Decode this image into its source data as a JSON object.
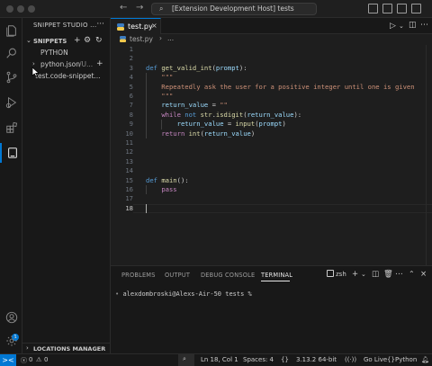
{
  "titlebar": {
    "back_icon": "arrow-left",
    "forward_icon": "arrow-right",
    "search_text": "[Extension Development Host] tests",
    "search_icon": "search-icon"
  },
  "activitybar": {
    "items": [
      "explorer-icon",
      "search-icon",
      "source-control-icon",
      "run-debug-icon",
      "extensions-icon",
      "snippet-studio-icon"
    ],
    "account_badge": "1"
  },
  "sidebar": {
    "title": "SNIPPET STUDIO ...",
    "more": "···",
    "section_label": "SNIPPETS",
    "section_chevron": "⌄",
    "tree": {
      "group": "PYTHON",
      "file1_chevron": "›",
      "file1": "python.json",
      "file1_detail": "/U...",
      "file1_add": "+",
      "file2": "test.code-snippet..."
    },
    "locations_label": "LOCATIONS MANAGER",
    "locations_chevron": "›"
  },
  "editor": {
    "tab_label": "test.py",
    "tab_close": "×",
    "breadcrumb_file": "test.py",
    "breadcrumb_sep": "›",
    "breadcrumb_more": "...",
    "lines": [
      {
        "n": "1",
        "segments": []
      },
      {
        "n": "2",
        "segments": []
      },
      {
        "n": "3",
        "segments": [
          {
            "t": "def ",
            "c": "kwb"
          },
          {
            "t": "get_valid_int",
            "c": "fn"
          },
          {
            "t": "(",
            "c": "df"
          },
          {
            "t": "prompt",
            "c": "vr"
          },
          {
            "t": "):",
            "c": "df"
          }
        ]
      },
      {
        "n": "4",
        "segments": [
          {
            "t": "    \"\"\"",
            "c": "st"
          }
        ]
      },
      {
        "n": "5",
        "segments": [
          {
            "t": "    Repeatedly ask the user for a positive integer until one is given",
            "c": "st"
          }
        ]
      },
      {
        "n": "6",
        "segments": [
          {
            "t": "    \"\"\"",
            "c": "st"
          }
        ]
      },
      {
        "n": "7",
        "segments": [
          {
            "t": "    ",
            "c": "df"
          },
          {
            "t": "return_value",
            "c": "vr"
          },
          {
            "t": " = ",
            "c": "df"
          },
          {
            "t": "\"\"",
            "c": "st"
          }
        ]
      },
      {
        "n": "8",
        "segments": [
          {
            "t": "    ",
            "c": "df"
          },
          {
            "t": "while",
            "c": "kw"
          },
          {
            "t": " ",
            "c": "df"
          },
          {
            "t": "not",
            "c": "kwb"
          },
          {
            "t": " ",
            "c": "df"
          },
          {
            "t": "str",
            "c": "fn"
          },
          {
            "t": ".",
            "c": "df"
          },
          {
            "t": "isdigit",
            "c": "fn"
          },
          {
            "t": "(",
            "c": "df"
          },
          {
            "t": "return_value",
            "c": "vr"
          },
          {
            "t": "):",
            "c": "df"
          }
        ]
      },
      {
        "n": "9",
        "segments": [
          {
            "t": "        ",
            "c": "df"
          },
          {
            "t": "return_value",
            "c": "vr"
          },
          {
            "t": " = ",
            "c": "df"
          },
          {
            "t": "input",
            "c": "fn"
          },
          {
            "t": "(",
            "c": "df"
          },
          {
            "t": "prompt",
            "c": "vr"
          },
          {
            "t": ")",
            "c": "df"
          }
        ]
      },
      {
        "n": "10",
        "segments": [
          {
            "t": "    ",
            "c": "df"
          },
          {
            "t": "return",
            "c": "kw"
          },
          {
            "t": " ",
            "c": "df"
          },
          {
            "t": "int",
            "c": "fn"
          },
          {
            "t": "(",
            "c": "df"
          },
          {
            "t": "return_value",
            "c": "vr"
          },
          {
            "t": ")",
            "c": "df"
          }
        ]
      },
      {
        "n": "11",
        "segments": []
      },
      {
        "n": "12",
        "segments": []
      },
      {
        "n": "13",
        "segments": []
      },
      {
        "n": "14",
        "segments": []
      },
      {
        "n": "15",
        "segments": [
          {
            "t": "def ",
            "c": "kwb"
          },
          {
            "t": "main",
            "c": "fn"
          },
          {
            "t": "():",
            "c": "df"
          }
        ]
      },
      {
        "n": "16",
        "segments": [
          {
            "t": "    ",
            "c": "df"
          },
          {
            "t": "pass",
            "c": "kw"
          }
        ]
      },
      {
        "n": "17",
        "segments": []
      },
      {
        "n": "18",
        "segments": []
      }
    ],
    "current_line": "18"
  },
  "panel": {
    "tabs": [
      "PROBLEMS",
      "OUTPUT",
      "DEBUG CONSOLE",
      "TERMINAL"
    ],
    "active_tab": "TERMINAL",
    "shell": "zsh",
    "terminal_text": "alexdombroski@Alexs-Air-50 tests %"
  },
  "statusbar": {
    "remote_icon": "><",
    "errors": "0",
    "warnings": "0",
    "cursor": "Ln 18, Col 1",
    "spaces": "Spaces: 4",
    "braces": "{}",
    "interpreter": "3.13.2 64-bit",
    "go_live": "Go Live",
    "language": "Python"
  },
  "colors": {
    "accent": "#0078d4",
    "keyword": "#c586c0",
    "keyword_blue": "#569cd6",
    "function": "#dcdcaa",
    "variable": "#9cdcfe",
    "string": "#ce9178"
  }
}
